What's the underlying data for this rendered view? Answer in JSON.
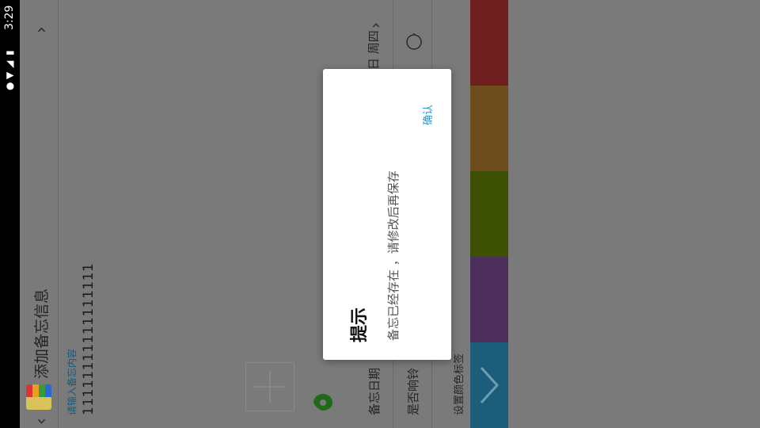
{
  "status_bar": {
    "time": "3:29",
    "icons": [
      "location-icon",
      "wifi-icon",
      "signal-icon",
      "battery-charging-icon"
    ]
  },
  "header": {
    "title": "添加备忘信息",
    "back_icon": "chevron-down-icon",
    "menu_icon": "chevron-right-icon",
    "app_icon": "memo-app-icon"
  },
  "memo": {
    "input_placeholder": "请输入备忘内容",
    "text": "11111111111111111",
    "add_photo_icon": "plus-icon",
    "location_icon": "map-pin-icon"
  },
  "settings": {
    "date_label": "备忘日期",
    "date_value": "日 周四",
    "bell_label": "是否响铃",
    "color_tag_label": "设置颜色标签"
  },
  "colors": {
    "red": "#6f1f1f",
    "orange": "#6e4d1d",
    "green": "#3e5004",
    "purple": "#4d2f5e",
    "blue": "#1b5d7a",
    "accent": "#1a98d5"
  },
  "dialog": {
    "title": "提示",
    "message": "备忘已经存在 ，请修改后再保存",
    "confirm_label": "确认"
  }
}
